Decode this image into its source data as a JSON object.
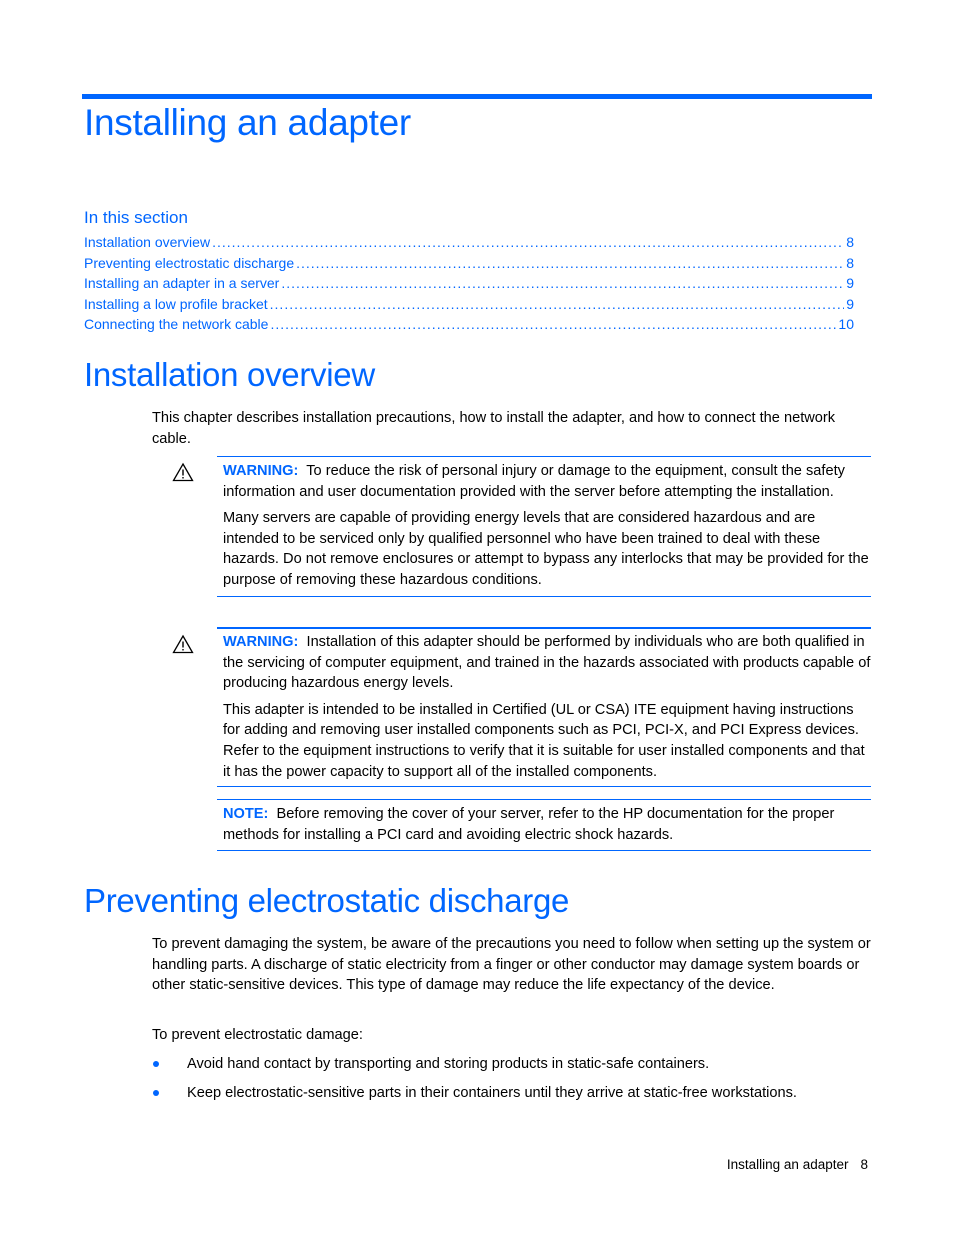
{
  "chapter": {
    "title": "Installing an adapter"
  },
  "toc": {
    "heading": "In this section",
    "items": [
      {
        "label": "Installation overview",
        "page": "8"
      },
      {
        "label": "Preventing electrostatic discharge",
        "page": "8"
      },
      {
        "label": "Installing an adapter in a server",
        "page": "9"
      },
      {
        "label": "Installing a low profile bracket",
        "page": "9"
      },
      {
        "label": "Connecting the network cable",
        "page": "10"
      }
    ]
  },
  "installation_overview": {
    "title": "Installation overview",
    "intro": "This chapter describes installation precautions, how to install the adapter, and how to connect the network cable.",
    "warning1": {
      "label": "WARNING:",
      "text": "To reduce the risk of personal injury or damage to the equipment, consult the safety information and user documentation provided with the server before attempting the installation.",
      "paragraph2": "Many servers are capable of providing energy levels that are considered hazardous and are intended to be serviced only by qualified personnel who have been trained to deal with these hazards. Do not remove enclosures or attempt to bypass any interlocks that may be provided for the purpose of removing these hazardous conditions."
    },
    "warning2": {
      "label": "WARNING:",
      "text": "Installation of this adapter should be performed by individuals who are both qualified in the servicing of computer equipment, and trained in the hazards associated with products capable of producing hazardous energy levels.",
      "paragraph2": "This adapter is intended to be installed in Certified (UL or CSA) ITE equipment having instructions for adding and removing user installed components such as PCI, PCI-X, and PCI Express devices. Refer to the equipment instructions to verify that it is suitable for user installed components and that it has the power capacity to support all of the installed components."
    },
    "note": {
      "label": "NOTE:",
      "text": "Before removing the cover of your server, refer to the HP documentation for the proper methods for installing a PCI card and avoiding electric shock hazards."
    }
  },
  "esd": {
    "title": "Preventing electrostatic discharge",
    "intro": "To prevent damaging the system, be aware of the precautions you need to follow when setting up the system or handling parts. A discharge of static electricity from a finger or other conductor may damage system boards or other static-sensitive devices. This type of damage may reduce the life expectancy of the device.",
    "lead": "To prevent electrostatic damage:",
    "bullets": [
      "Avoid hand contact by transporting and storing products in static-safe containers.",
      "Keep electrostatic-sensitive parts in their containers until they arrive at static-free workstations."
    ]
  },
  "footer": {
    "section": "Installing an adapter",
    "page": "8"
  },
  "colors": {
    "accent": "#0066ff",
    "text": "#000000"
  }
}
